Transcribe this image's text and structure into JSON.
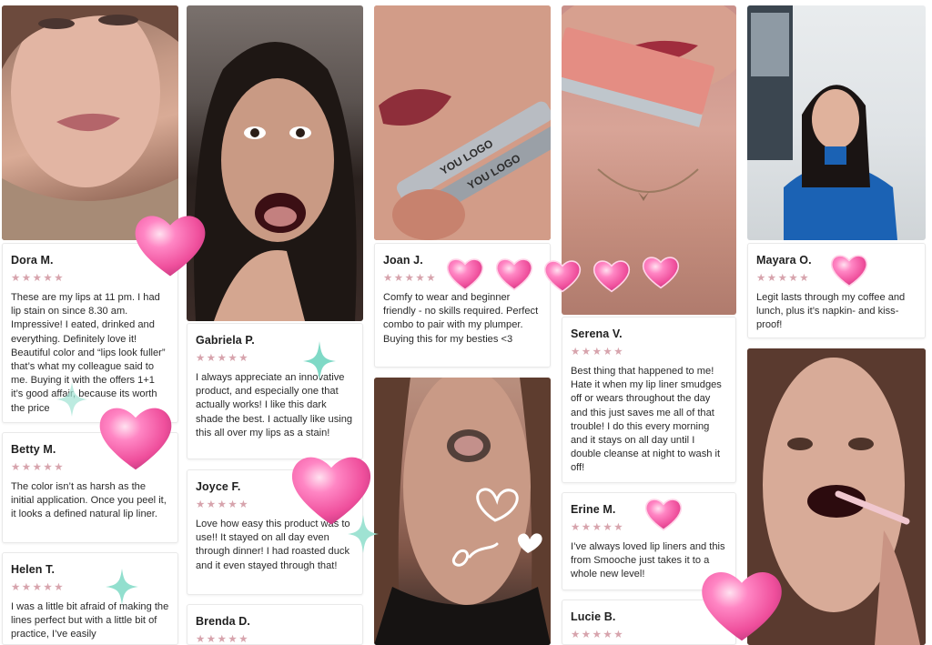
{
  "reviews": {
    "dora": {
      "name": "Dora M.",
      "stars": "★★★★★",
      "text": "These are my lips at 11 pm. I had lip stain on since 8.30 am. Impressive! I eated, drinked and everything. Definitely love it! Beautiful color and “lips look fuller” that’s what my colleague said to me. Buying it with the offers 1+1 it’s good affair, because its worth the price"
    },
    "betty": {
      "name": "Betty M.",
      "stars": "★★★★★",
      "text": "The color isn’t as harsh as the initial application. Once you peel it, it looks a defined natural lip liner."
    },
    "helen": {
      "name": "Helen T.",
      "stars": "★★★★★",
      "text": "I was a little bit afraid of making the lines perfect but with a little bit of practice, I’ve easily"
    },
    "gabriela": {
      "name": "Gabriela P.",
      "stars": "★★★★★",
      "text": "I always appreciate an innovative product, and especially one that actually works! I like this dark shade the best. I actually like using this all over my lips as a stain!"
    },
    "joyce": {
      "name": "Joyce F.",
      "stars": "★★★★★",
      "text": "Love how easy this product was to use!! It stayed on all day even through dinner! I had roasted duck and it even stayed through that!"
    },
    "brenda": {
      "name": "Brenda D.",
      "stars": "★★★★★",
      "text": ""
    },
    "joan": {
      "name": "Joan J.",
      "stars": "★★★★★",
      "text": "Comfy to wear and beginner friendly - no skills required. Perfect combo to pair with my plumper. Buying this for my besties <3"
    },
    "serena": {
      "name": "Serena V.",
      "stars": "★★★★★",
      "text": "Best thing that happened to me! Hate it when my lip liner smudges off or wears throughout the day and this just saves me all of that trouble! I do this every morning and it stays on all day until I double cleanse at night to wash it off!"
    },
    "erine": {
      "name": "Erine M.",
      "stars": "★★★★★",
      "text": "I’ve always loved lip liners and this from Smooche just takes it to a whole new level!"
    },
    "lucie": {
      "name": "Lucie B.",
      "stars": "★★★★★",
      "text": ""
    },
    "mayara": {
      "name": "Mayara O.",
      "stars": "★★★★★",
      "text": "Legit lasts through my coffee and lunch, plus it’s napkin- and kiss-proof!"
    }
  },
  "product_print": {
    "logo_text_1": "YOU LOGO",
    "logo_text_2": "YOU LOGO"
  },
  "colors": {
    "star": "#d7a4ad",
    "heart": "#f35ea8",
    "sparkle": "#7fd9c6",
    "card_border": "#e9e9e9"
  }
}
